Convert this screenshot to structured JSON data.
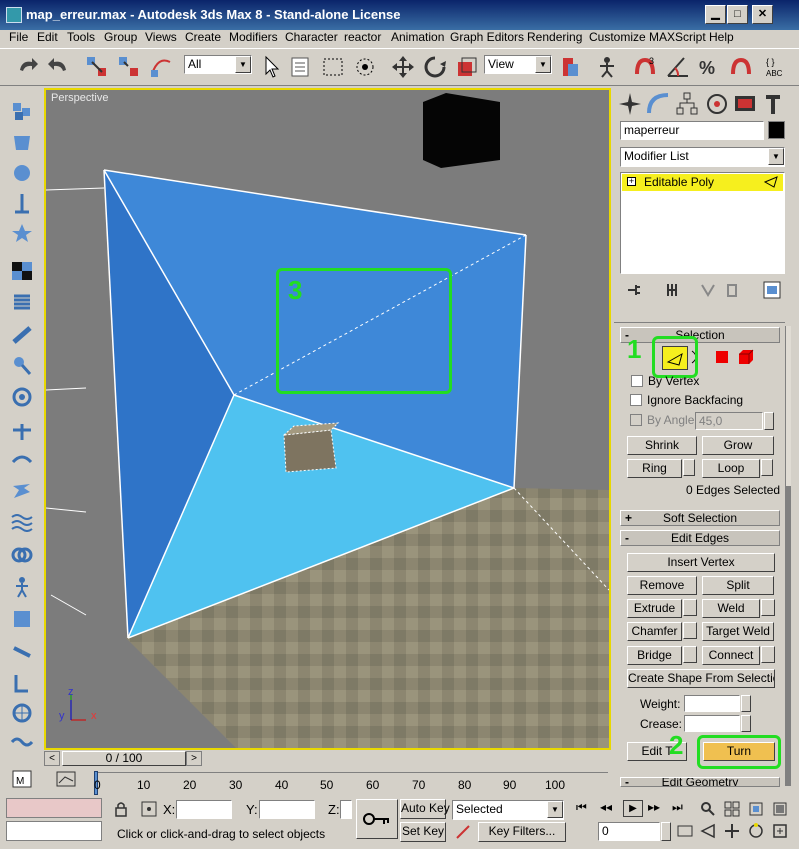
{
  "window": {
    "title": "map_erreur.max - Autodesk 3ds Max 8  - Stand-alone License",
    "min_glyph": "▁",
    "max_glyph": "□",
    "close_glyph": "✕"
  },
  "menu": [
    "File",
    "Edit",
    "Tools",
    "Group",
    "Views",
    "Create",
    "Modifiers",
    "Character",
    "reactor",
    "Animation",
    "Graph Editors",
    "Rendering",
    "Customize",
    "MAXScript",
    "Help"
  ],
  "toolbar": {
    "selection_filter": "All",
    "reference_coord": "View"
  },
  "viewport": {
    "label": "Perspective",
    "axis_x": "x",
    "axis_y": "y",
    "axis_z": "z"
  },
  "command_panel": {
    "object_name": "maperreur",
    "modifier_list": "Modifier List",
    "stack_item": "Editable Poly",
    "selection": {
      "header": "Selection",
      "by_vertex": "By Vertex",
      "ignore_backfacing": "Ignore Backfacing",
      "by_angle": "By Angle:",
      "angle_value": "45,0",
      "shrink": "Shrink",
      "grow": "Grow",
      "ring": "Ring",
      "loop": "Loop",
      "status": "0 Edges Selected"
    },
    "soft_selection": "Soft Selection",
    "edit_edges": {
      "header": "Edit Edges",
      "insert_vertex": "Insert Vertex",
      "remove": "Remove",
      "split": "Split",
      "extrude": "Extrude",
      "weld": "Weld",
      "chamfer": "Chamfer",
      "target_weld": "Target Weld",
      "bridge": "Bridge",
      "connect": "Connect",
      "create_shape": "Create Shape From Selection",
      "weight": "Weight:",
      "crease": "Crease:",
      "edit_tri": "Edit T",
      "turn": "Turn"
    },
    "edit_geometry": "Edit Geometry"
  },
  "annotations": {
    "one": "1",
    "two": "2",
    "three": "3"
  },
  "timeline": {
    "frame": "0 / 100",
    "ticks": [
      "0",
      "10",
      "20",
      "30",
      "40",
      "50",
      "60",
      "70",
      "80",
      "90",
      "100"
    ]
  },
  "status": {
    "x_label": "X:",
    "y_label": "Y:",
    "z_label": "Z:",
    "auto_key": "Auto Key",
    "set_key": "Set Key",
    "key_mode": "Selected",
    "key_filters": "Key Filters...",
    "prompt": "Click or click-and-drag to select objects",
    "current_frame": "0"
  }
}
